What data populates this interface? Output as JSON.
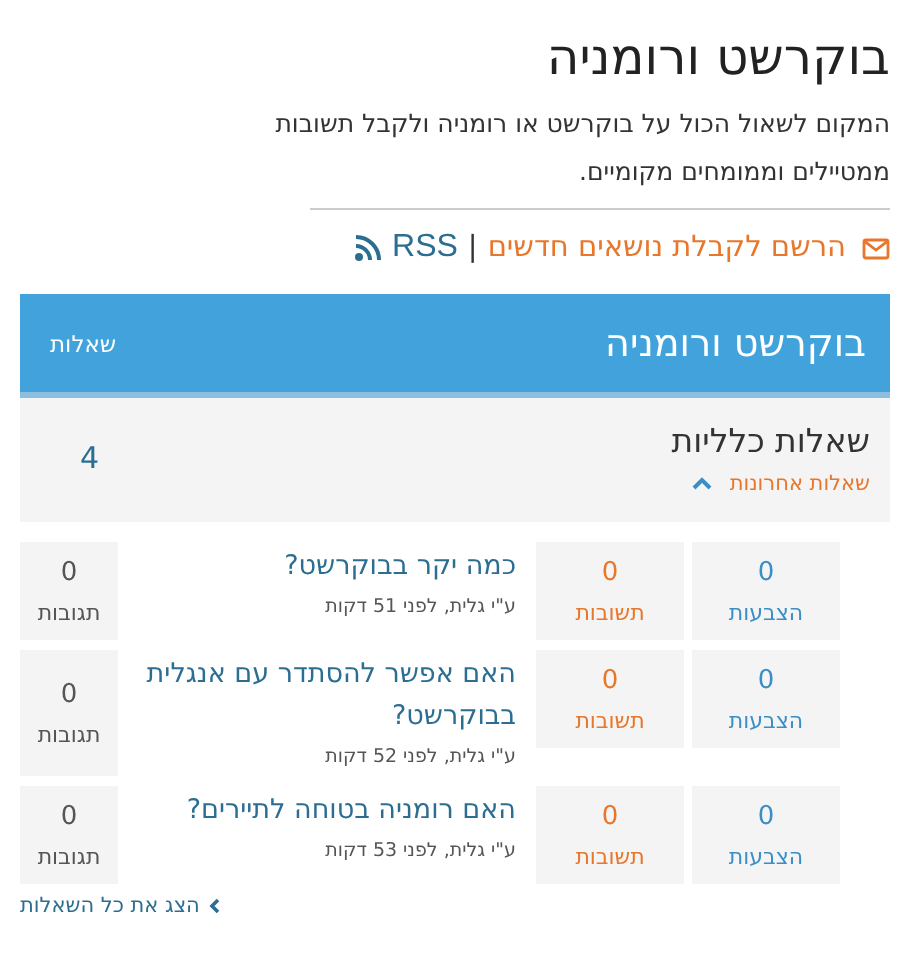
{
  "header": {
    "title": "בוקרשט ורומניה",
    "description": "המקום לשאול הכול על בוקרשט או רומניה ולקבל תשובות ממטיילים וממומחים מקומיים."
  },
  "subscribe": {
    "label": "הרשם לקבלת נושאים חדשים",
    "separator": "|",
    "rss": "RSS"
  },
  "panel": {
    "title": "בוקרשט ורומניה",
    "count_heading": "שאלות"
  },
  "category": {
    "name": "שאלות כלליות",
    "toggle": "שאלות אחרונות",
    "expanded": true,
    "count": "4"
  },
  "questions": [
    {
      "votes": "0",
      "votes_label": "הצבעות",
      "answers": "0",
      "answers_label": "תשובות",
      "title": "כמה יקר בבוקרשט?",
      "meta": "ע\"י גלית, לפני 51 דקות",
      "comments": "0",
      "comments_label": "תגובות"
    },
    {
      "votes": "0",
      "votes_label": "הצבעות",
      "answers": "0",
      "answers_label": "תשובות",
      "title": "האם אפשר להסתדר עם אנגלית בבוקרשט?",
      "meta": "ע\"י גלית, לפני 52 דקות",
      "comments": "0",
      "comments_label": "תגובות"
    },
    {
      "votes": "0",
      "votes_label": "הצבעות",
      "answers": "0",
      "answers_label": "תשובות",
      "title": "האם רומניה בטוחה לתיירים?",
      "meta": "ע\"י גלית, לפני 53 דקות",
      "comments": "0",
      "comments_label": "תגובות"
    }
  ],
  "show_all": "הצג את כל השאלות"
}
